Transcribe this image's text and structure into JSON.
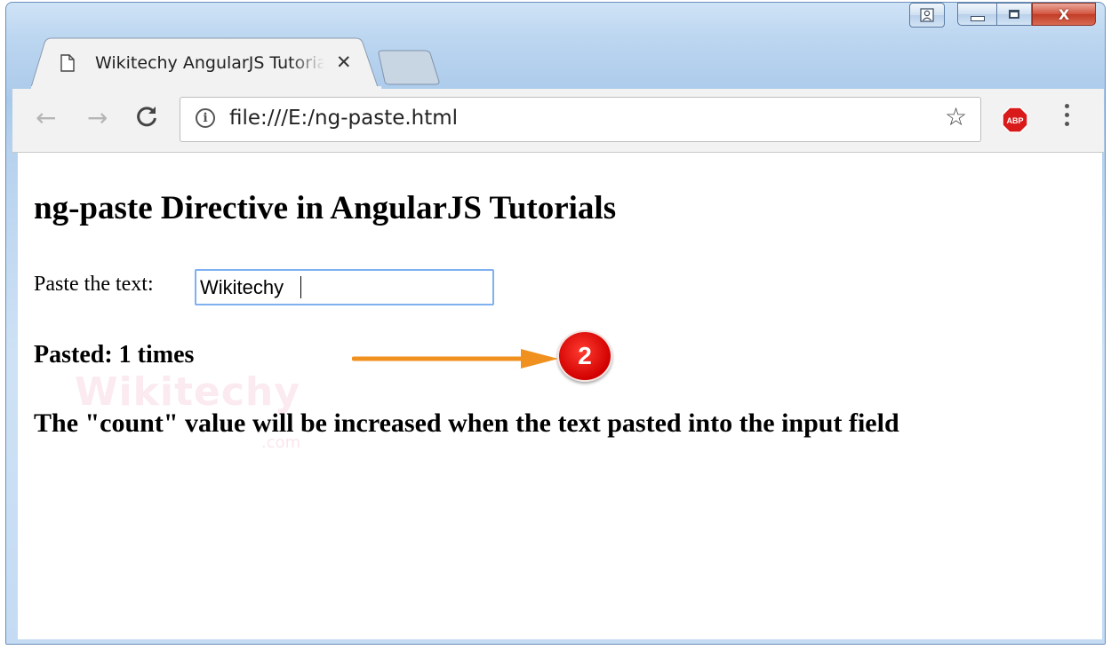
{
  "browser": {
    "tab_title": "Wikitechy AngularJS Tutorials",
    "tab_close": "✕",
    "url": "file:///E:/ng-paste.html",
    "info_glyph": "i",
    "back_glyph": "←",
    "forward_glyph": "→",
    "reload_glyph": "C",
    "star_glyph": "☆",
    "abp_label": "ABP",
    "close_glyph": "X"
  },
  "page": {
    "heading": "ng-paste Directive in AngularJS Tutorials",
    "paste_label": "Paste the text:",
    "input_value": "Wikitechy",
    "pasted_text": "Pasted: 1 times",
    "note": "The \"count\" value will be increased when the text pasted into the input field"
  },
  "annotation": {
    "badge_number": "2",
    "arrow_color": "#f0901e",
    "badge_color": "#e00000"
  },
  "watermark": {
    "text": "Wikitechy",
    "sub": ".com"
  }
}
